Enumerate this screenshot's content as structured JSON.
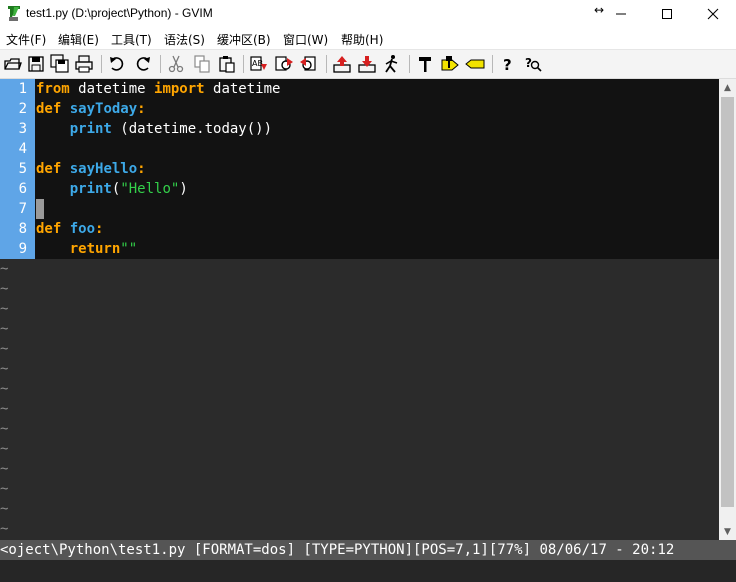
{
  "window": {
    "title": "test1.py (D:\\project\\Python) - GVIM",
    "resize_glyph": "↔",
    "minimize_glyph": "—",
    "maximize_glyph": "☐",
    "close_glyph": "✕"
  },
  "menu": {
    "items": [
      {
        "label": "文件(F)"
      },
      {
        "label": "编辑(E)"
      },
      {
        "label": "工具(T)"
      },
      {
        "label": "语法(S)"
      },
      {
        "label": "缓冲区(B)"
      },
      {
        "label": "窗口(W)"
      },
      {
        "label": "帮助(H)"
      }
    ]
  },
  "toolbar": {
    "buttons": [
      "open-icon",
      "save-icon",
      "save-all-icon",
      "print-icon",
      "undo-icon",
      "redo-icon",
      "cut-icon",
      "copy-icon",
      "paste-icon",
      "find-replace-icon",
      "find-next-icon",
      "find-prev-icon",
      "load-session-icon",
      "save-session-icon",
      "run-script-icon",
      "make-icon",
      "build-tags-icon",
      "jump-tag-icon",
      "help-icon",
      "find-help-icon"
    ]
  },
  "editor": {
    "lines": [
      {
        "num": "1",
        "tokens": [
          {
            "t": "from",
            "c": "kw"
          },
          {
            "t": " datetime ",
            "c": ""
          },
          {
            "t": "import",
            "c": "kw"
          },
          {
            "t": " datetime",
            "c": ""
          }
        ]
      },
      {
        "num": "2",
        "tokens": [
          {
            "t": "def",
            "c": "kw"
          },
          {
            "t": " ",
            "c": ""
          },
          {
            "t": "sayToday",
            "c": "fn"
          },
          {
            "t": ":",
            "c": "kw"
          }
        ]
      },
      {
        "num": "3",
        "tokens": [
          {
            "t": "    ",
            "c": ""
          },
          {
            "t": "print",
            "c": "kw2"
          },
          {
            "t": " (datetime.today())",
            "c": ""
          }
        ]
      },
      {
        "num": "4",
        "tokens": []
      },
      {
        "num": "5",
        "tokens": [
          {
            "t": "def",
            "c": "kw"
          },
          {
            "t": " ",
            "c": ""
          },
          {
            "t": "sayHello",
            "c": "fn"
          },
          {
            "t": ":",
            "c": "kw"
          }
        ]
      },
      {
        "num": "6",
        "tokens": [
          {
            "t": "    ",
            "c": ""
          },
          {
            "t": "print",
            "c": "kw2"
          },
          {
            "t": "(",
            "c": ""
          },
          {
            "t": "\"Hello\"",
            "c": "str"
          },
          {
            "t": ")",
            "c": ""
          }
        ]
      },
      {
        "num": "7",
        "tokens": []
      },
      {
        "num": "8",
        "tokens": [
          {
            "t": "def",
            "c": "kw"
          },
          {
            "t": " ",
            "c": ""
          },
          {
            "t": "foo",
            "c": "fn"
          },
          {
            "t": ":",
            "c": "kw"
          }
        ]
      },
      {
        "num": "9",
        "tokens": [
          {
            "t": "    ",
            "c": ""
          },
          {
            "t": "return",
            "c": "kw"
          },
          {
            "t": "\"\"",
            "c": "str"
          }
        ]
      }
    ],
    "tilde": "~",
    "tilde_count": 14
  },
  "status": {
    "text": "<oject\\Python\\test1.py [FORMAT=dos] [TYPE=PYTHON][POS=7,1][77%] 08/06/17 - 20:12"
  },
  "colors": {
    "gutter": "#5fa5e7",
    "keyword": "#ffa500",
    "function": "#3da9e8",
    "string": "#33d04a"
  }
}
